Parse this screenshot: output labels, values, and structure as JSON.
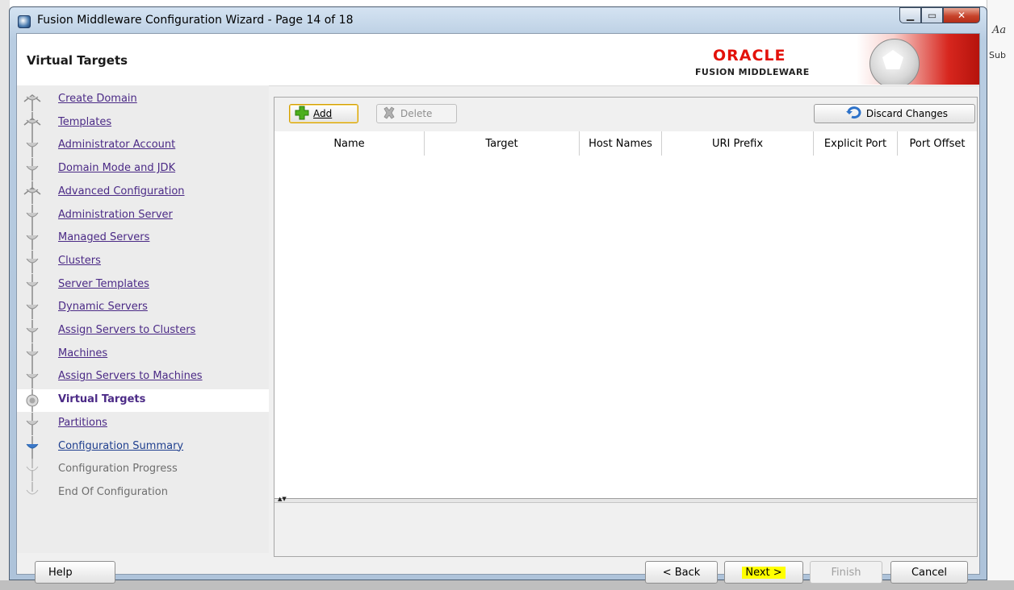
{
  "window": {
    "title": "Fusion Middleware Configuration Wizard - Page 14 of 18",
    "controls": [
      "minimize",
      "maximize",
      "close"
    ]
  },
  "background_app": {
    "text1": "Aa",
    "text2": "Sub"
  },
  "header": {
    "page_title": "Virtual Targets",
    "brand_word": "ORACLE",
    "brand_sub": "FUSION MIDDLEWARE"
  },
  "nav": {
    "items": [
      {
        "label": "Create Domain",
        "state": "visited"
      },
      {
        "label": "Templates",
        "state": "visited"
      },
      {
        "label": "Administrator Account",
        "state": "visited"
      },
      {
        "label": "Domain Mode and JDK",
        "state": "visited"
      },
      {
        "label": "Advanced Configuration",
        "state": "visited"
      },
      {
        "label": "Administration Server",
        "state": "visited"
      },
      {
        "label": "Managed Servers",
        "state": "visited"
      },
      {
        "label": "Clusters",
        "state": "visited"
      },
      {
        "label": "Server Templates",
        "state": "visited"
      },
      {
        "label": "Dynamic Servers",
        "state": "visited"
      },
      {
        "label": "Assign Servers to Clusters",
        "state": "visited"
      },
      {
        "label": "Machines",
        "state": "visited"
      },
      {
        "label": "Assign Servers to Machines",
        "state": "visited"
      },
      {
        "label": "Virtual Targets",
        "state": "current"
      },
      {
        "label": "Partitions",
        "state": "visited"
      },
      {
        "label": "Configuration Summary",
        "state": "next"
      },
      {
        "label": "Configuration Progress",
        "state": "disabled"
      },
      {
        "label": "End Of Configuration",
        "state": "disabled"
      }
    ]
  },
  "toolbar": {
    "add_label": "Add",
    "delete_label": "Delete",
    "discard_label": "Discard Changes"
  },
  "table": {
    "columns": [
      "Name",
      "Target",
      "Host Names",
      "URI Prefix",
      "Explicit Port",
      "Port Offset"
    ],
    "rows": []
  },
  "footer": {
    "help_label": "Help",
    "back_label": "< Back",
    "next_label": "Next >",
    "finish_label": "Finish",
    "cancel_label": "Cancel"
  },
  "colors": {
    "oracle_red": "#e3120b",
    "link_purple": "#4b2a86",
    "next_highlight": "#ffff00"
  }
}
